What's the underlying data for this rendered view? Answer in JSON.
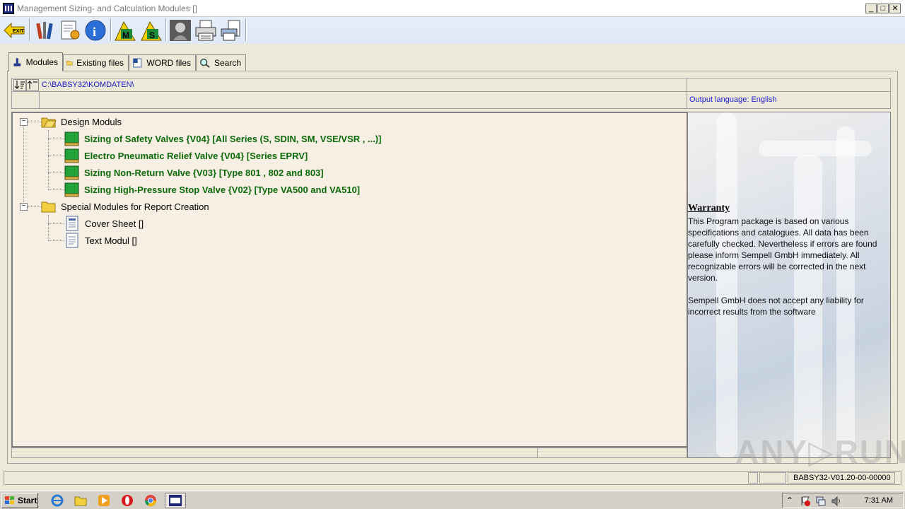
{
  "window": {
    "title": "Management Sizing- and Calculation Modules []",
    "minimize": "_",
    "maximize": "□",
    "close": "✕"
  },
  "toolbar": {
    "buttons": [
      {
        "icon": "exit-icon",
        "label": "EXIT"
      },
      {
        "icon": "tools-icon"
      },
      {
        "icon": "edit-settings-icon"
      },
      {
        "icon": "info-icon"
      },
      {
        "icon": "module-m-icon",
        "label": "M"
      },
      {
        "icon": "module-s-icon",
        "label": "S"
      },
      {
        "icon": "portrait-icon"
      },
      {
        "icon": "print-icon"
      },
      {
        "icon": "print-setup-icon"
      }
    ]
  },
  "tabs": [
    {
      "label": "Modules",
      "active": true
    },
    {
      "label": "Existing files",
      "active": false
    },
    {
      "label": "WORD files",
      "active": false
    },
    {
      "label": "Search",
      "active": false
    }
  ],
  "path": "C:\\BABSY32\\KOMDATEN\\",
  "output_language": "Output language: English",
  "tree": {
    "expander_open": "−",
    "groups": [
      {
        "label": "Design Moduls",
        "items": [
          "Sizing of Safety Valves {V04} [All Series (S, SDIN, SM, VSE/VSR , ...)]",
          "Electro Pneumatic Relief Valve {V04} [Series EPRV]",
          "Sizing Non-Return Valve {V03} [Type 801 , 802 and 803]",
          "Sizing High-Pressure Stop Valve {V02} [Type VA500 and VA510]"
        ]
      },
      {
        "label": "Special Modules for Report Creation",
        "items": [
          "Cover Sheet []",
          "Text Modul []"
        ]
      }
    ]
  },
  "warranty": {
    "title": "Warranty",
    "paragraph1": "This Program package is based on various specifications and catalogues. All data has been carefully checked. Nevertheless if errors are found please inform Sempell GmbH immediately. All recognizable errors will be corrected in the next version.",
    "paragraph2": "Sempell GmbH does not accept any liability for incorrect results from the software"
  },
  "watermark": "ANY▷RUN",
  "statusbar": {
    "version": "BABSY32-V01.20-00-00000"
  },
  "taskbar": {
    "start": "Start",
    "clock": "7:31 AM",
    "tray_arrow": "⌃"
  },
  "colors": {
    "tree_background": "#f7efe3",
    "module_label": "#0b6b0b",
    "path_text": "#1a1ad0",
    "toolbar_bg": "#e6eef9"
  }
}
